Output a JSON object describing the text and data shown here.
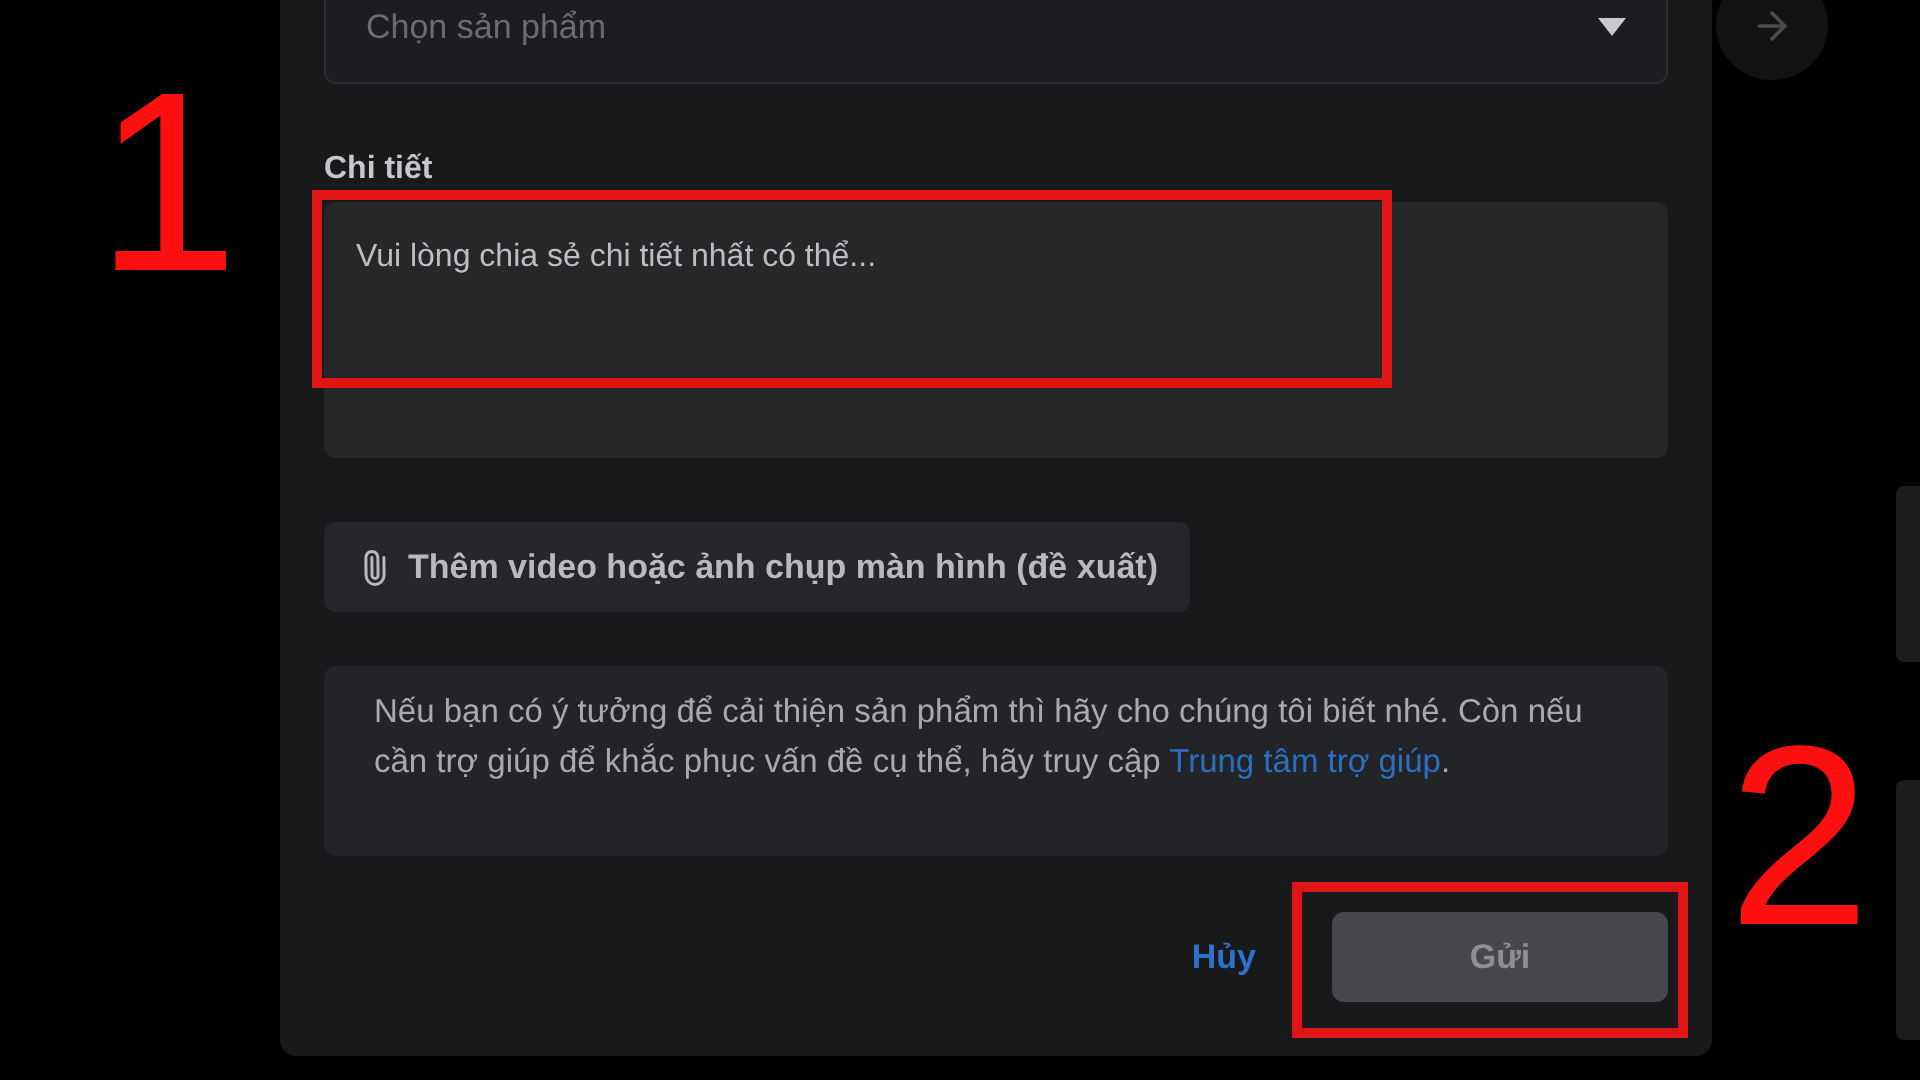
{
  "product_select": {
    "placeholder": "Chọn sản phẩm"
  },
  "details": {
    "label": "Chi tiết",
    "placeholder": "Vui lòng chia sẻ chi tiết nhất có thể..."
  },
  "attach_button": {
    "label": "Thêm video hoặc ảnh chụp màn hình (đề xuất)"
  },
  "info": {
    "text": "Nếu bạn có ý tưởng để cải thiện sản phẩm thì hãy cho chúng tôi biết nhé. Còn nếu cần trợ giúp để khắc phục vấn đề cụ thể, hãy truy cập",
    "link": "Trung tâm trợ giúp",
    "suffix": "."
  },
  "actions": {
    "cancel": "Hủy",
    "submit": {
      "label": "Gửi",
      "disabled": true
    }
  },
  "annotations": [
    {
      "label": "1"
    },
    {
      "label": "2"
    }
  ]
}
